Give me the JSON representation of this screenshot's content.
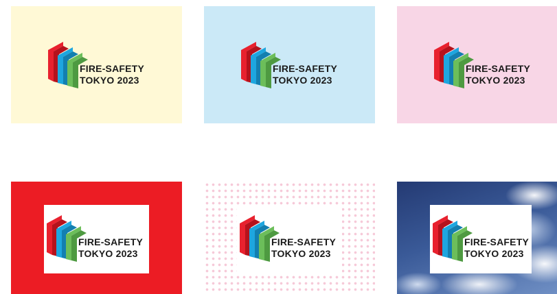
{
  "logo": {
    "line1": "FIRE-SAFETY",
    "line2": "TOKYO 2023",
    "colors": {
      "red": "#e8212e",
      "blue": "#1ea6df",
      "green": "#6cbe5a",
      "text": "#1a1a1a"
    }
  },
  "variants": [
    {
      "background": "light-yellow",
      "color": "#fff9d6"
    },
    {
      "background": "light-blue",
      "color": "#cbe9f7"
    },
    {
      "background": "light-pink",
      "color": "#f8d6e6"
    },
    {
      "background": "red",
      "color": "#ec1c24",
      "plate": "white"
    },
    {
      "background": "pink-dot-pattern",
      "color": "#f6c9d8",
      "plate": "white"
    },
    {
      "background": "blue-sky-photo",
      "plate": "white"
    }
  ]
}
